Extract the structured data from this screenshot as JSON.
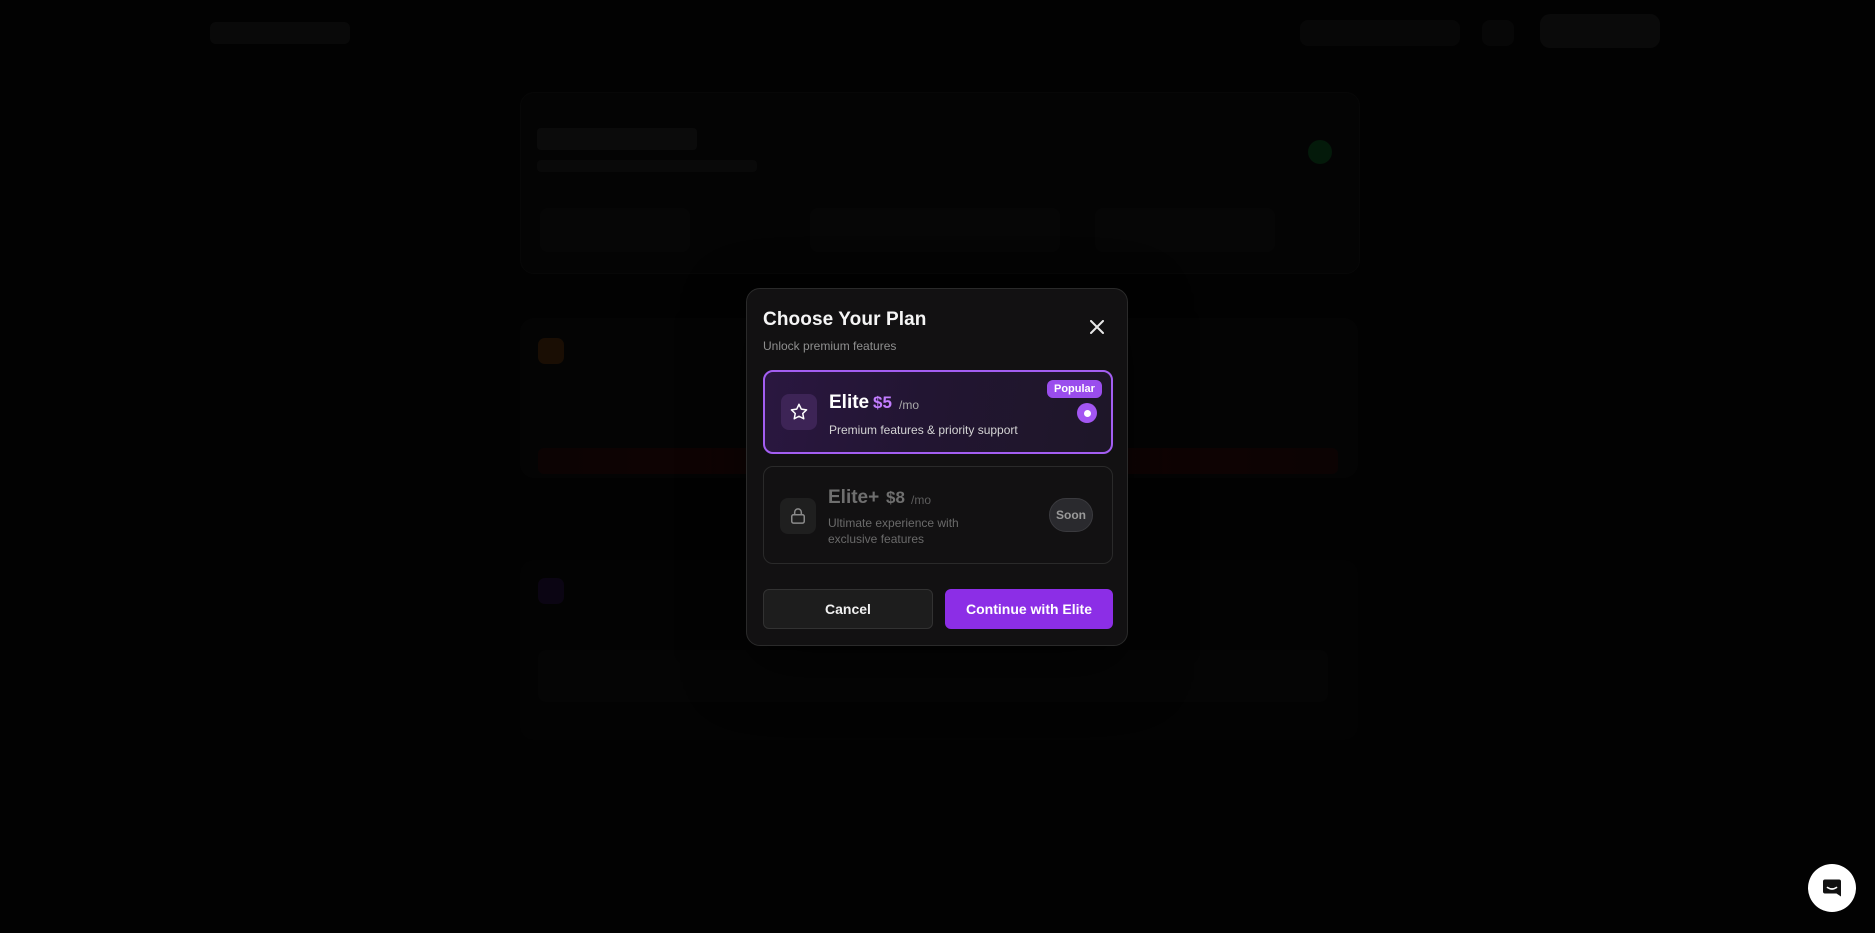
{
  "modal": {
    "title": "Choose Your Plan",
    "subtitle": "Unlock premium features",
    "close_icon": "close-icon"
  },
  "plans": [
    {
      "name": "Elite",
      "price": "$5",
      "period": "/mo",
      "description": "Premium features & priority support",
      "badge": "Popular",
      "icon": "star-icon",
      "selected": true
    },
    {
      "name": "Elite+",
      "price": "$8",
      "period": "/mo",
      "description": "Ultimate experience with exclusive features",
      "badge": "Soon",
      "icon": "lock-icon",
      "selected": false
    }
  ],
  "actions": {
    "cancel_label": "Cancel",
    "continue_label": "Continue with Elite"
  },
  "colors": {
    "accent": "#9a4ded",
    "continue_button": "#8c2ee6",
    "price_highlight": "#c27dff"
  },
  "chat_launcher": {
    "icon": "chat-icon"
  }
}
